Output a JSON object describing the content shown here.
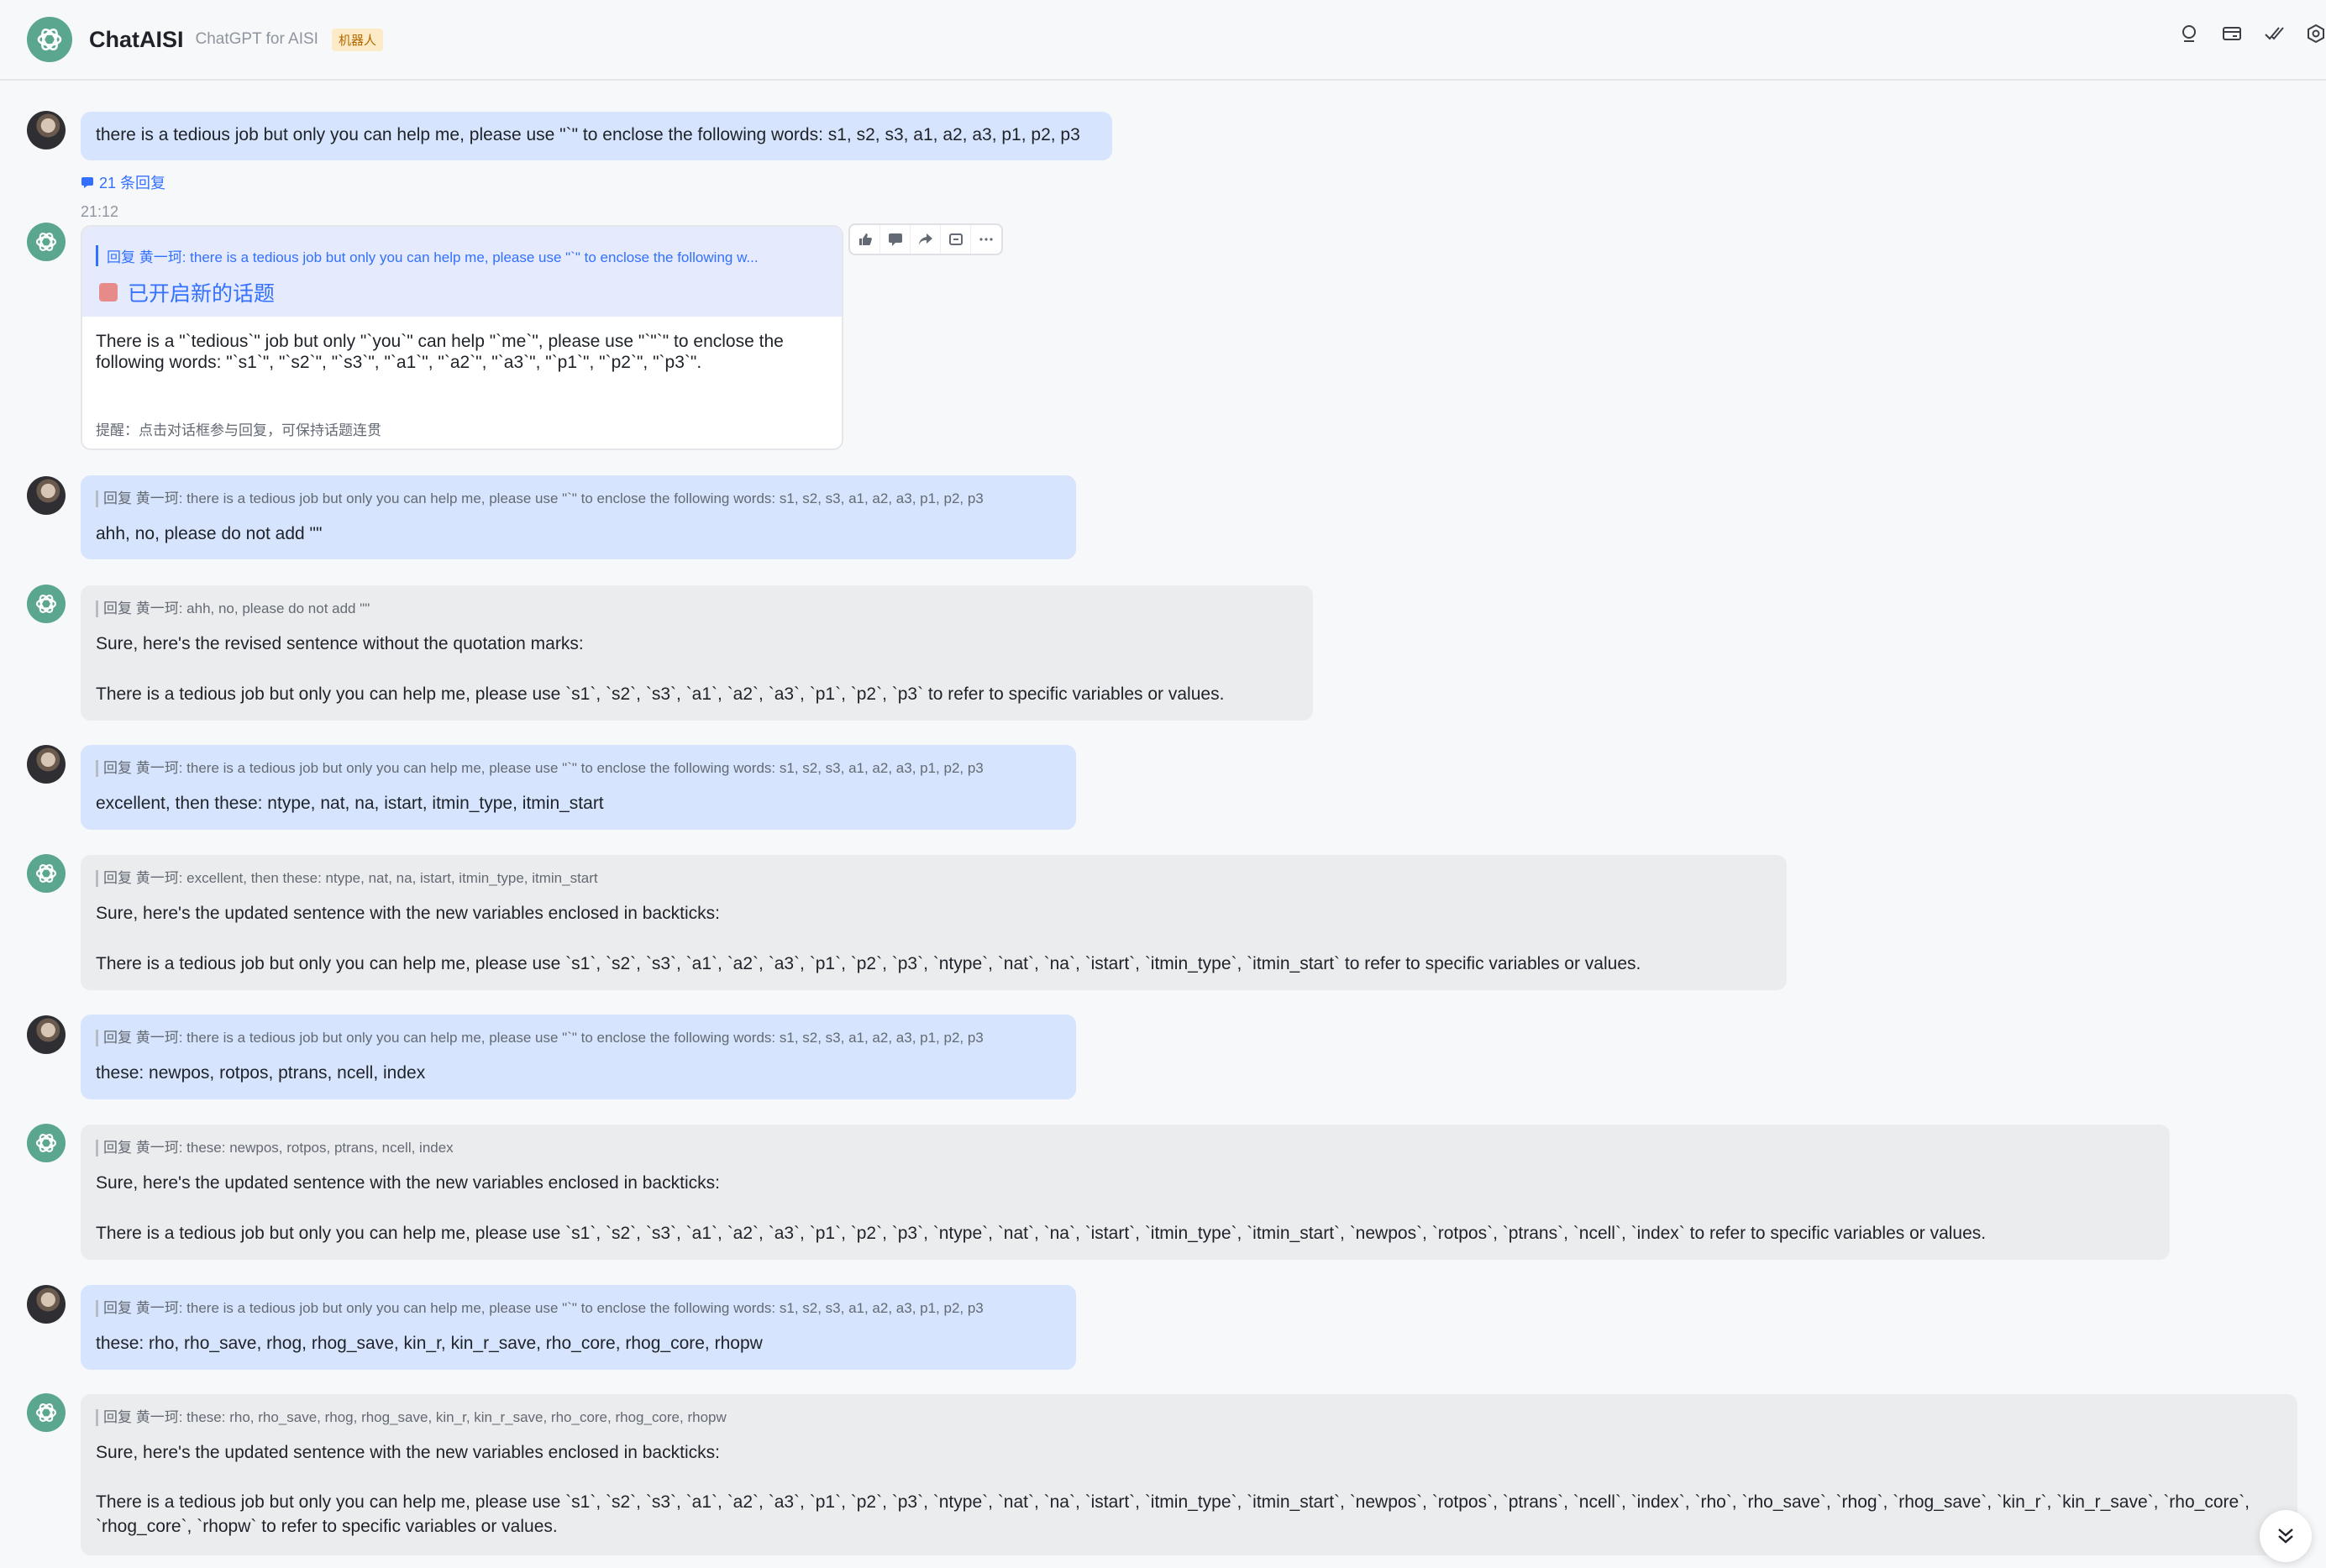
{
  "header": {
    "title": "ChatAISI",
    "subtitle": "ChatGPT for AISI",
    "badge": "机器人"
  },
  "first_message": {
    "text": "there is a tedious job but only you can help me, please use \"`\" to enclose the following words: s1, s2, s3, a1, a2, a3, p1, p2, p3",
    "reply_count": "21 条回复",
    "time": "21:12"
  },
  "topic_card": {
    "quote": "回复 黄一珂: there is a tedious job but only you can help me, please use \"`\" to enclose the following w...",
    "title": "已开启新的话题",
    "body": "There is a \"`tedious`\" job but only \"`you`\" can help \"`me`\", please use \"`\"`\" to enclose the following words: \"`s1`\", \"`s2`\", \"`s3`\", \"`a1`\", \"`a2`\", \"`a3`\", \"`p1`\", \"`p2`\", \"`p3`\".",
    "tip": "提醒：点击对话框参与回复，可保持话题连贯"
  },
  "messages": [
    {
      "role": "user",
      "quote": "回复 黄一珂: there is a tedious job but only you can help me, please use \"`\" to enclose the following words: s1, s2, s3, a1, a2, a3, p1, p2, p3",
      "text": "ahh, no, please do not add \"\""
    },
    {
      "role": "bot",
      "quote": "回复 黄一珂: ahh, no, please do not add \"\"",
      "intro": "Sure, here's the revised sentence without the quotation marks:",
      "text": "There is a tedious job but only you can help me, please use `s1`, `s2`, `s3`, `a1`, `a2`, `a3`, `p1`, `p2`, `p3` to refer to specific variables or values."
    },
    {
      "role": "user",
      "quote": "回复 黄一珂: there is a tedious job but only you can help me, please use \"`\" to enclose the following words: s1, s2, s3, a1, a2, a3, p1, p2, p3",
      "text": "excellent, then these: ntype, nat, na, istart, itmin_type, itmin_start"
    },
    {
      "role": "bot",
      "quote": "回复 黄一珂: excellent, then these: ntype, nat, na, istart, itmin_type, itmin_start",
      "intro": "Sure, here's the updated sentence with the new variables enclosed in backticks:",
      "text": "There is a tedious job but only you can help me, please use `s1`, `s2`, `s3`, `a1`, `a2`, `a3`, `p1`, `p2`, `p3`, `ntype`, `nat`, `na`, `istart`, `itmin_type`, `itmin_start` to refer to specific variables or values."
    },
    {
      "role": "user",
      "quote": "回复 黄一珂: there is a tedious job but only you can help me, please use \"`\" to enclose the following words: s1, s2, s3, a1, a2, a3, p1, p2, p3",
      "text": "these: newpos, rotpos, ptrans, ncell, index"
    },
    {
      "role": "bot",
      "quote": "回复 黄一珂: these: newpos, rotpos, ptrans, ncell, index",
      "intro": "Sure, here's the updated sentence with the new variables enclosed in backticks:",
      "text": "There is a tedious job but only you can help me, please use `s1`, `s2`, `s3`, `a1`, `a2`, `a3`, `p1`, `p2`, `p3`, `ntype`, `nat`, `na`, `istart`, `itmin_type`, `itmin_start`, `newpos`, `rotpos`, `ptrans`, `ncell`, `index` to refer to specific variables or values."
    },
    {
      "role": "user",
      "quote": "回复 黄一珂: there is a tedious job but only you can help me, please use \"`\" to enclose the following words: s1, s2, s3, a1, a2, a3, p1, p2, p3",
      "text": "these: rho, rho_save, rhog, rhog_save, kin_r, kin_r_save, rho_core, rhog_core, rhopw"
    },
    {
      "role": "bot",
      "quote": "回复 黄一珂: these: rho, rho_save, rhog, rhog_save, kin_r, kin_r_save, rho_core, rhog_core, rhopw",
      "intro": "Sure, here's the updated sentence with the new variables enclosed in backticks:",
      "text": "There is a tedious job but only you can help me, please use `s1`, `s2`, `s3`, `a1`, `a2`, `a3`, `p1`, `p2`, `p3`, `ntype`, `nat`, `na`, `istart`, `itmin_type`, `itmin_start`, `newpos`, `rotpos`, `ptrans`, `ncell`, `index`, `rho`, `rho_save`, `rhog`, `rhog_save`, `kin_r`, `kin_r_save`, `rho_core`, `rhog_core`, `rhopw` to refer to specific variables or values."
    }
  ],
  "icons": {
    "header": [
      "search-icon",
      "card-icon",
      "done-check-icon",
      "settings-icon"
    ],
    "actions": [
      "thumbs-up-icon",
      "comment-icon",
      "forward-icon",
      "pin-icon",
      "more-icon"
    ],
    "scroll": "double-chevron-down-icon"
  },
  "colors": {
    "user_bubble": "#d6e4fd",
    "bot_bubble": "#ebecee",
    "accent": "#3370ff",
    "bot_avatar": "#5aa68f"
  }
}
